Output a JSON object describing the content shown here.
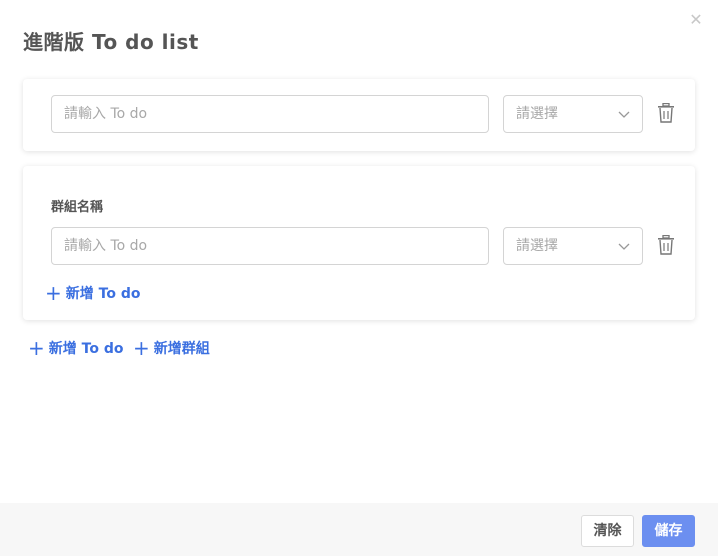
{
  "dialog": {
    "title": "進階版 To do list",
    "close_icon": "close-icon"
  },
  "ungrouped": {
    "todo_placeholder": "請輸入 To do",
    "select_placeholder": "請選擇"
  },
  "group": {
    "name_label": "群組名稱",
    "todo_placeholder": "請輸入 To do",
    "select_placeholder": "請選擇",
    "add_todo_label": "新增 To do"
  },
  "actions": {
    "add_todo_label": "新增 To do",
    "add_group_label": "新增群組"
  },
  "footer": {
    "clear_label": "清除",
    "save_label": "儲存"
  },
  "colors": {
    "accent": "#3b6fe0",
    "primary_button": "#6c8ff0"
  }
}
